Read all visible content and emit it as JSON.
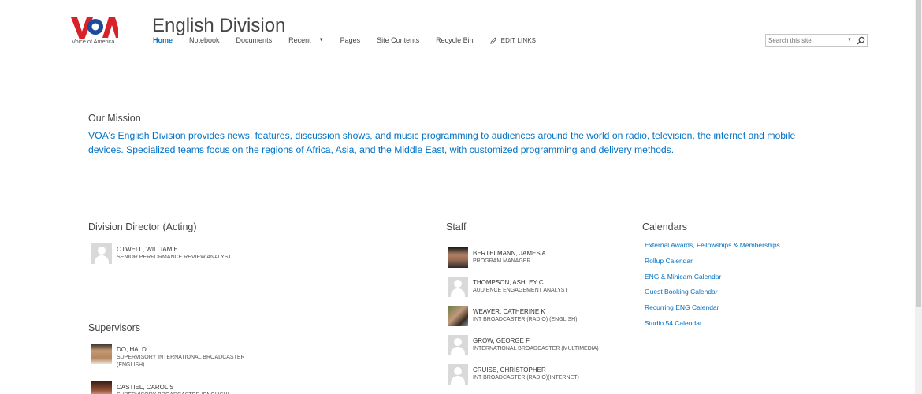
{
  "header": {
    "logo_text": "Voice of America",
    "site_title": "English Division",
    "nav": [
      {
        "label": "Home"
      },
      {
        "label": "Notebook"
      },
      {
        "label": "Documents"
      },
      {
        "label": "Recent"
      },
      {
        "label": "Pages"
      },
      {
        "label": "Site Contents"
      },
      {
        "label": "Recycle Bin"
      }
    ],
    "edit_links": "EDIT LINKS",
    "search_placeholder": "Search this site"
  },
  "mission": {
    "title": "Our Mission",
    "text": "VOA's English Division provides news, features, discussion shows, and music programming to audiences around the world on radio, television, the internet and mobile devices. Specialized teams focus on the regions of Africa, Asia, and the Middle East, with customized programming and delivery methods."
  },
  "director": {
    "title": "Division Director (Acting)",
    "people": [
      {
        "name": "OTWELL, WILLIAM E",
        "role": "SENIOR PERFORMANCE REVIEW ANALYST"
      }
    ]
  },
  "supervisors": {
    "title": "Supervisors",
    "people": [
      {
        "name": "DO, HAI D",
        "role": "SUPERVISORY INTERNATIONAL BROADCASTER (ENGLISH)"
      },
      {
        "name": "CASTIEL, CAROL S",
        "role": "SUPERVISORY BROADCASTER (ENGLISH)"
      }
    ]
  },
  "staff": {
    "title": "Staff",
    "people": [
      {
        "name": "BERTELMANN, JAMES A",
        "role": "PROGRAM MANAGER"
      },
      {
        "name": "THOMPSON, ASHLEY C",
        "role": "AUDIENCE ENGAGEMENT ANALYST"
      },
      {
        "name": "WEAVER, CATHERINE K",
        "role": "INT BROADCASTER (RADIO) (ENGLISH)"
      },
      {
        "name": "GROW, GEORGE F",
        "role": "INTERNATIONAL BROADCASTER (MULTIMEDIA)"
      },
      {
        "name": "CRUISE, CHRISTOPHER",
        "role": "INT BROADCASTER (RADIO)(INTERNET)"
      }
    ]
  },
  "calendars": {
    "title": "Calendars",
    "links": [
      "External Awards, Fellowships & Memberships",
      "Rollup Calendar",
      "ENG & Minicam Calendar",
      "Guest Booking Calendar",
      "Recurring ENG Calendar",
      "Studio 54 Calendar"
    ]
  },
  "colors": {
    "accent": "#0072c6",
    "logo_red": "#d8222a",
    "logo_blue": "#1b4b9a"
  }
}
